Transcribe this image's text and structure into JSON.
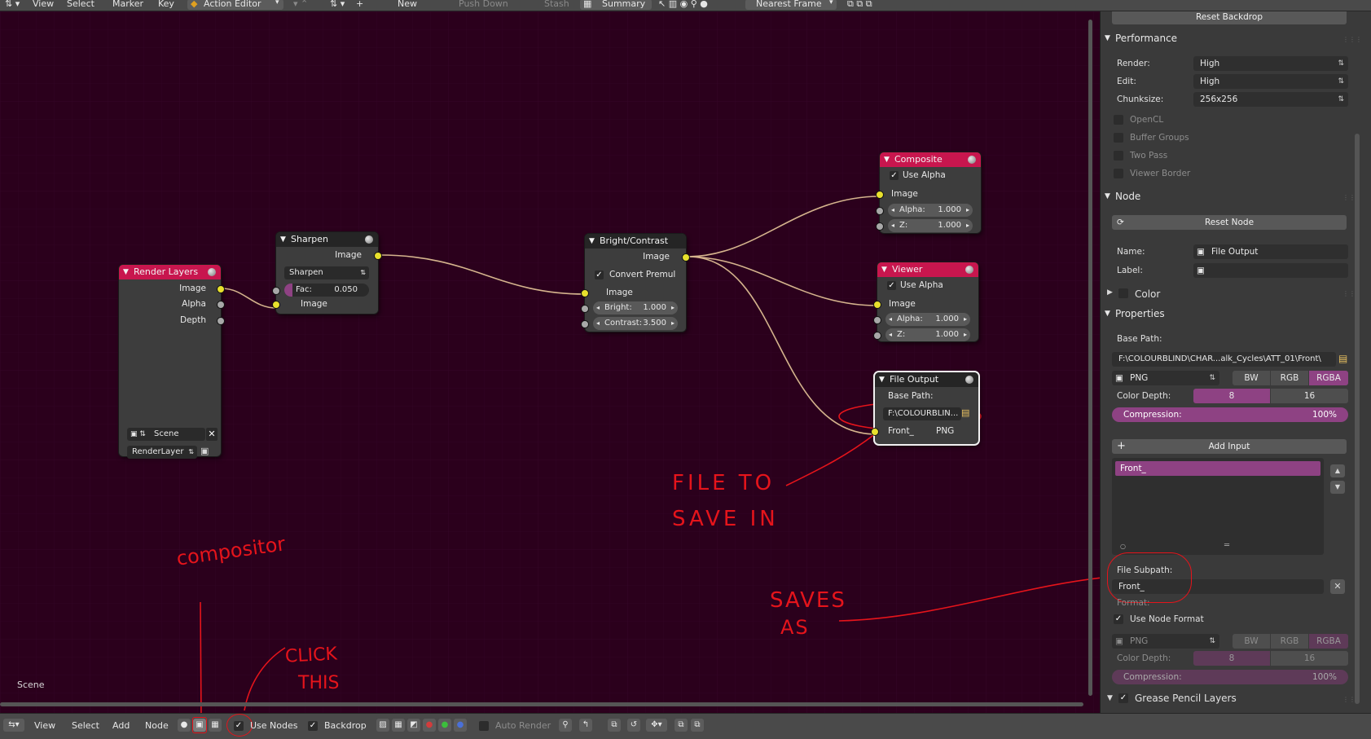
{
  "header": {
    "view": "View",
    "select": "Select",
    "marker": "Marker",
    "key": "Key",
    "editor_mode": "Action Editor",
    "new": "New",
    "push_down": "Push Down",
    "stash": "Stash",
    "summary": "Summary",
    "snap_mode": "Nearest Frame"
  },
  "editor": {
    "scene_label": "Scene",
    "nodes": {
      "render_layers": {
        "title": "Render Layers",
        "outputs": [
          "Image",
          "Alpha",
          "Depth"
        ],
        "scene": "Scene",
        "layer": "RenderLayer"
      },
      "sharpen": {
        "title": "Sharpen",
        "output": "Image",
        "mode": "Sharpen",
        "fac_label": "Fac:",
        "fac_value": "0.050",
        "input": "Image"
      },
      "bright_contrast": {
        "title": "Bright/Contrast",
        "output": "Image",
        "convert_premul": "Convert Premul",
        "input": "Image",
        "bright_label": "Bright:",
        "bright_value": "1.000",
        "contrast_label": "Contrast:",
        "contrast_value": "3.500"
      },
      "composite": {
        "title": "Composite",
        "use_alpha": "Use Alpha",
        "image": "Image",
        "alpha_label": "Alpha:",
        "alpha_value": "1.000",
        "z_label": "Z:",
        "z_value": "1.000"
      },
      "viewer": {
        "title": "Viewer",
        "use_alpha": "Use Alpha",
        "image": "Image",
        "alpha_label": "Alpha:",
        "alpha_value": "1.000",
        "z_label": "Z:",
        "z_value": "1.000"
      },
      "file_output": {
        "title": "File Output",
        "base_path_label": "Base Path:",
        "base_path": "F:\\COLOURBLIN...",
        "input_name": "Front_",
        "input_format": "PNG"
      }
    }
  },
  "annotations": {
    "compositor": "compositor",
    "click_this_1": "CLICK",
    "click_this_2": "THIS",
    "file_to_1": "FILE TO",
    "file_to_2": "SAVE  IN",
    "saves_as_1": "SAVES",
    "saves_as_2": "AS"
  },
  "footer": {
    "view": "View",
    "select": "Select",
    "add": "Add",
    "node": "Node",
    "use_nodes": "Use Nodes",
    "backdrop": "Backdrop",
    "auto_render": "Auto Render"
  },
  "panel": {
    "reset_backdrop": "Reset Backdrop",
    "performance": "Performance",
    "render_label": "Render:",
    "render_value": "High",
    "edit_label": "Edit:",
    "edit_value": "High",
    "chunksize_label": "Chunksize:",
    "chunksize_value": "256x256",
    "opencl": "OpenCL",
    "buffer_groups": "Buffer Groups",
    "two_pass": "Two Pass",
    "viewer_border": "Viewer Border",
    "node_section": "Node",
    "reset_node": "Reset Node",
    "name_label": "Name:",
    "name_value": "File Output",
    "label_label": "Label:",
    "color": "Color",
    "properties": "Properties",
    "base_path_label": "Base Path:",
    "base_path_value": "F:\\COLOURBLIND\\CHAR...alk_Cycles\\ATT_01\\Front\\",
    "format": "PNG",
    "bw": "BW",
    "rgb": "RGB",
    "rgba": "RGBA",
    "color_depth_label": "Color Depth:",
    "depth_8": "8",
    "depth_16": "16",
    "compression_label": "Compression:",
    "compression_value": "100%",
    "add_input": "Add Input",
    "input_item": "Front_",
    "file_subpath_label": "File Subpath:",
    "file_subpath_value": "Front_",
    "format_label": "Format:",
    "use_node_format": "Use Node Format",
    "format2": "PNG",
    "color_depth2_label": "Color Depth:",
    "compression2_label": "Compression:",
    "compression2_value": "100%",
    "grease_pencil": "Grease Pencil Layers"
  },
  "colors": {
    "editor_bg": "#2b001c",
    "node_header": "#c8164e",
    "accent": "#8e4283",
    "socket_image": "#e8e02d",
    "annotation": "#e5141b"
  }
}
